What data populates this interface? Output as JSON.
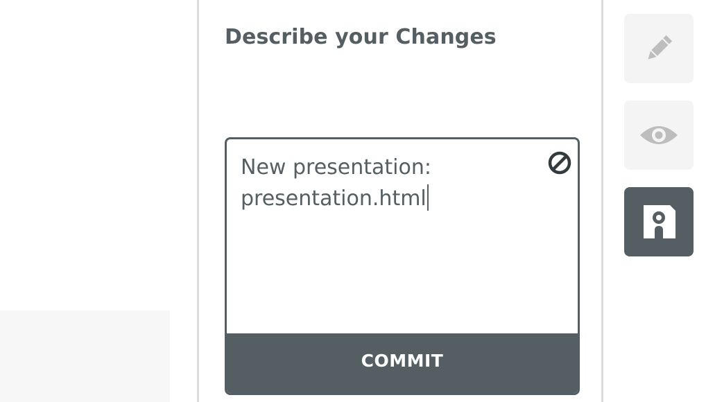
{
  "panel": {
    "title": "Describe your Changes",
    "message": {
      "line1": "New presentation:",
      "line2": "presentation.html",
      "clear_icon": "clear-icon"
    },
    "commit_label": "COMMIT"
  },
  "toolbar": {
    "items": [
      {
        "icon": "pencil-icon",
        "state": "inactive"
      },
      {
        "icon": "eye-icon",
        "state": "inactive"
      },
      {
        "icon": "save-icon",
        "state": "active"
      }
    ]
  },
  "colors": {
    "accent": "#545e63",
    "inactive_icon": "#bdbdbd",
    "button_bg": "#f4f4f4",
    "border": "#dcdcdc"
  }
}
